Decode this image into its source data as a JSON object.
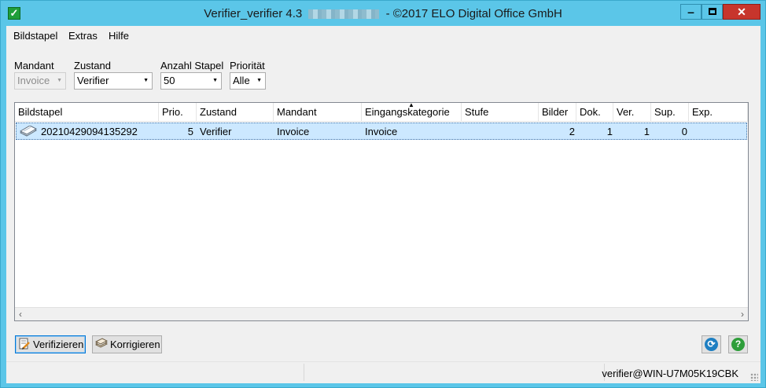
{
  "window": {
    "title_prefix": "Verifier_verifier 4.3",
    "title_suffix": "- ©2017 ELO Digital Office GmbH",
    "controls": {
      "minimize": "‒",
      "close": "✕"
    }
  },
  "menu": [
    {
      "label": "Bildstapel"
    },
    {
      "label": "Extras"
    },
    {
      "label": "Hilfe"
    }
  ],
  "filters": {
    "mandant": {
      "label": "Mandant",
      "value": "Invoice"
    },
    "zustand": {
      "label": "Zustand",
      "value": "Verifier"
    },
    "anzahl": {
      "label": "Anzahl Stapel",
      "value": "50"
    },
    "prioritaet": {
      "label": "Priorität",
      "value": "Alle"
    }
  },
  "table": {
    "columns": [
      "Bildstapel",
      "Prio.",
      "Zustand",
      "Mandant",
      "Eingangskategorie",
      "Stufe",
      "Bilder",
      "Dok.",
      "Ver.",
      "Sup.",
      "Exp."
    ],
    "rows": [
      {
        "bildstapel": "20210429094135292",
        "prio": "5",
        "zustand": "Verifier",
        "mandant": "Invoice",
        "eingangskategorie": "Invoice",
        "stufe": "",
        "bilder": "2",
        "dok": "1",
        "ver": "1",
        "sup": "0",
        "exp": ""
      }
    ]
  },
  "buttons": {
    "verifizieren": "Verifizieren",
    "korrigieren": "Korrigieren"
  },
  "status": {
    "user": "verifier@WIN-U7M05K19CBK"
  },
  "colors": {
    "titlebar": "#5bc6e8",
    "close_button": "#c7352c",
    "selection": "#cce8ff",
    "refresh_icon": "#1e7fc2",
    "help_icon": "#2e9e3a"
  }
}
